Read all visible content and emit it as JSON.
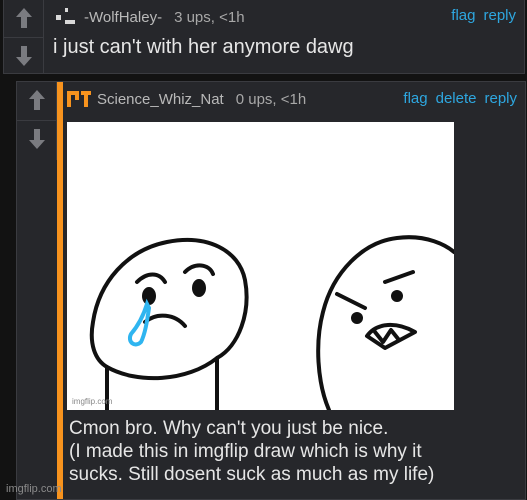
{
  "top_comment": {
    "username": "-WolfHaley-",
    "score": "3 ups, <1h",
    "actions": {
      "flag": "flag",
      "reply": "reply"
    },
    "text": "i just can't with her anymore dawg"
  },
  "reply_comment": {
    "username": "Science_Whiz_Nat",
    "score": "0 ups, <1h",
    "actions": {
      "flag": "flag",
      "delete": "delete",
      "reply": "reply"
    },
    "image_watermark": "imgflip.com",
    "caption_lines": [
      "Cmon bro. Why can't you just be nice.",
      "(I made this in imgflip draw which is why it",
      "sucks. Still dosent suck as much as my life)"
    ]
  },
  "footer_watermark": "imgflip.com",
  "colors": {
    "link": "#2ea7e0",
    "accent_bar": "#f7931e",
    "panel": "#26272b",
    "tear": "#2fb5f0"
  },
  "icons": [
    "upvote-arrow-icon",
    "downvote-arrow-icon",
    "user-avatar-icon"
  ]
}
